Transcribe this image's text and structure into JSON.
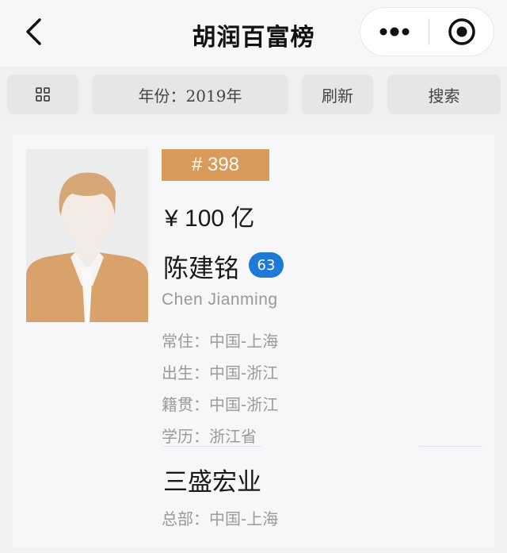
{
  "navbar": {
    "title": "胡润百富榜",
    "icons": {
      "back": "chevron-left-icon",
      "more": "more-dots-icon",
      "close": "target-close-icon"
    }
  },
  "toolbar": {
    "grid_icon": "grid-icon",
    "year_label": "年份：2019年",
    "refresh_label": "刷新",
    "search_label": "搜索"
  },
  "profile": {
    "rank": "# 398",
    "wealth": "¥ 100 亿",
    "name_zh": "陈建铭",
    "age": "63",
    "name_en": "Chen Jianming",
    "details": [
      {
        "label": "常住：",
        "value": "中国-上海"
      },
      {
        "label": "出生：",
        "value": "中国-浙江"
      },
      {
        "label": "籍贯：",
        "value": "中国-浙江"
      },
      {
        "label": "学历：",
        "value": "浙江省"
      }
    ],
    "company": "三盛宏业",
    "hq": {
      "label": "总部：",
      "value": "中国-上海"
    }
  },
  "colors": {
    "rank_badge": "#d99a5a",
    "age_badge": "#1e7ad8",
    "avatar_hair": "#d8a777",
    "avatar_shirt": "#d9a26a"
  }
}
